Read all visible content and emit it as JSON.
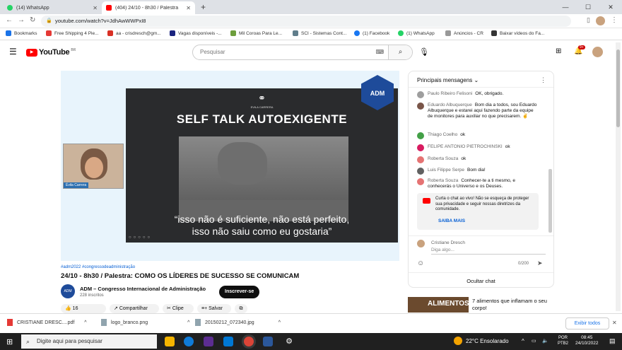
{
  "tabs": [
    {
      "title": "(14) WhatsApp",
      "color": "#25d366"
    },
    {
      "title": "(404) 24/10 - 8h30 / Palestra",
      "color": "#ff0000"
    }
  ],
  "url": "youtube.com/watch?v=JdhAwWWPxI8",
  "bookmarks": [
    {
      "label": "Bookmarks",
      "color": "#1a73e8"
    },
    {
      "label": "Free Shipping 4 Pie...",
      "color": "#e53935"
    },
    {
      "label": "aa - crisdresch@gm...",
      "color": "#d93025"
    },
    {
      "label": "Vagas disponíveis -...",
      "color": "#1a237e"
    },
    {
      "label": "Mil Coroas Para Le...",
      "color": "#6d9e3c"
    },
    {
      "label": "SCI - Sistemas Cont...",
      "color": "#607d8b"
    },
    {
      "label": "(1) Facebook",
      "color": "#1877f2"
    },
    {
      "label": "(1) WhatsApp",
      "color": "#25d366"
    },
    {
      "label": "Anúncios - CR",
      "color": "#999999"
    },
    {
      "label": "Baixar vídeos do Fa...",
      "color": "#333333"
    }
  ],
  "youtube": {
    "logo": "YouTube",
    "region": "BR",
    "search_placeholder": "Pesquisar",
    "notif_count": "9+"
  },
  "video": {
    "slide_title": "SELF TALK AUTOEXIGENTE",
    "slide_brand": "EVILA CARRERA",
    "quote_line1": "“isso não é suficiente, não está perfeito,",
    "quote_line2": "isso não saiu como eu gostaria”",
    "cam_label": "Évila Carrera",
    "badge": "ADM",
    "hashtags": "#adm2022 #congressodeadministração",
    "title": "24/10 - 8h30 / Palestra: COMO OS LÍDERES DE SUCESSO SE COMUNICAM",
    "channel": "ADM – Congresso Internacional de Administração",
    "subs": "228 inscritos",
    "subscribe": "Inscrever-se",
    "likes": "16",
    "share": "Compartilhar",
    "clip": "Clipe",
    "save": "Salvar"
  },
  "chat": {
    "header": "Principais mensagens",
    "messages": [
      {
        "name": "Paulo Ribeiro Felisoni",
        "text": "OK, obrigado.",
        "color": "#9e9e9e"
      },
      {
        "name": "Eduardo Albuquerque",
        "text": "Bom dia a todos, sou Eduardo Albuquerque e estarei aqui fazendo parte da equipe de monitores para auxiliar no que precisarem. ✌",
        "color": "#795548"
      },
      {
        "name": "Thiago Coelho",
        "text": "ok",
        "color": "#43a047"
      },
      {
        "name": "FELIPE ANTONIO PIETROCHINSKI",
        "text": "ok",
        "color": "#d81b60"
      },
      {
        "name": "Roberta Souza",
        "text": "ok",
        "color": "#e57373"
      },
      {
        "name": "Luis Filippe Serpe",
        "text": "Bom dia!",
        "color": "#616161"
      },
      {
        "name": "Roberta Souza",
        "text": "Conhecer-te a ti mesmo, e conhecerás o Universo e os Deuses.",
        "color": "#e57373"
      }
    ],
    "notice": "Curta o chat ao vivo! Não se esqueça de proteger sua privacidade e seguir nossas diretrizes da comunidade.",
    "learn_more": "SAIBA MAIS",
    "user": "Cristiane Dresch",
    "input_placeholder": "Diga algo...",
    "counter": "0/200",
    "hide": "Ocultar chat"
  },
  "recommendation": {
    "thumb_text": "ALIMENTOS",
    "title": "7 alimentos que inflamam o seu corpo!"
  },
  "downloads": {
    "files": [
      "CRISTIANE DRESC....pdf",
      "logo_branco.png",
      "20150212_072340.jpg"
    ],
    "show_all": "Exibir todos"
  },
  "taskbar": {
    "search": "Digite aqui para pesquisar",
    "weather": "22°C  Ensolarado",
    "lang1": "POR",
    "lang2": "PTB2",
    "time": "08:45",
    "date": "24/10/2022"
  }
}
